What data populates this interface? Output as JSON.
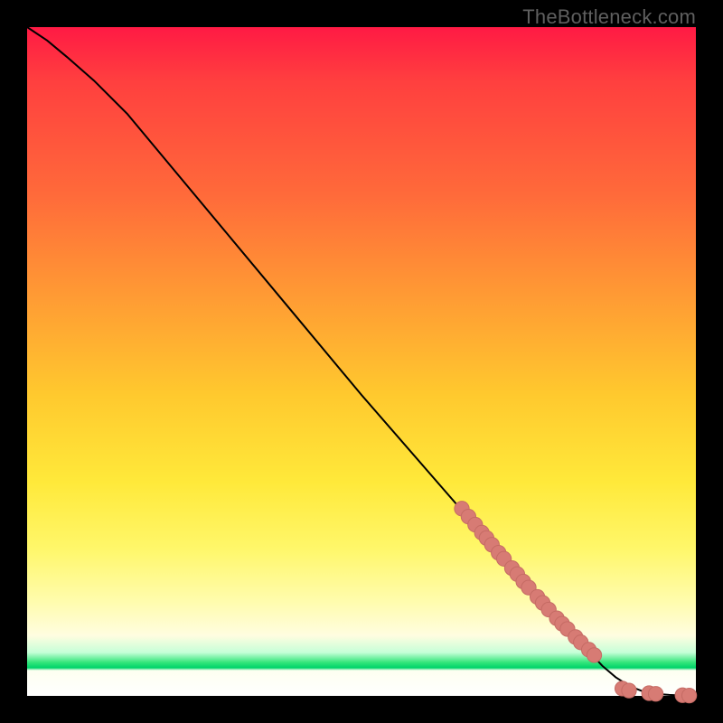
{
  "watermark": "TheBottleneck.com",
  "colors": {
    "background": "#000000",
    "curve": "#000000",
    "marker_fill": "#d77b74",
    "marker_stroke": "#c56b64"
  },
  "chart_data": {
    "type": "line",
    "title": "",
    "xlabel": "",
    "ylabel": "",
    "xlim": [
      0,
      100
    ],
    "ylim": [
      0,
      100
    ],
    "series": [
      {
        "name": "curve",
        "x": [
          0,
          3,
          6,
          10,
          15,
          20,
          30,
          40,
          50,
          60,
          70,
          80,
          86,
          88,
          90,
          92,
          94,
          96,
          98,
          100
        ],
        "y": [
          100,
          98,
          95.5,
          92,
          87,
          81,
          69,
          57,
          45,
          33.5,
          22,
          11,
          4.5,
          2.8,
          1.5,
          0.7,
          0.3,
          0.15,
          0.05,
          0
        ]
      }
    ],
    "markers": [
      {
        "x": 65,
        "y": 28,
        "r": 1.1
      },
      {
        "x": 66,
        "y": 26.8,
        "r": 1.1
      },
      {
        "x": 67,
        "y": 25.6,
        "r": 1.1
      },
      {
        "x": 68,
        "y": 24.4,
        "r": 1.1
      },
      {
        "x": 68.7,
        "y": 23.6,
        "r": 1.1
      },
      {
        "x": 69.5,
        "y": 22.6,
        "r": 1.1
      },
      {
        "x": 70.5,
        "y": 21.4,
        "r": 1.1
      },
      {
        "x": 71.3,
        "y": 20.5,
        "r": 1.1
      },
      {
        "x": 72.5,
        "y": 19.1,
        "r": 1.1
      },
      {
        "x": 73.3,
        "y": 18.2,
        "r": 1.1
      },
      {
        "x": 74.2,
        "y": 17.1,
        "r": 1.1
      },
      {
        "x": 75,
        "y": 16.2,
        "r": 1.1
      },
      {
        "x": 76.3,
        "y": 14.8,
        "r": 1.1
      },
      {
        "x": 77.1,
        "y": 13.9,
        "r": 1.1
      },
      {
        "x": 78,
        "y": 12.9,
        "r": 1.1
      },
      {
        "x": 79.2,
        "y": 11.6,
        "r": 1.1
      },
      {
        "x": 80,
        "y": 10.8,
        "r": 1.1
      },
      {
        "x": 80.8,
        "y": 10,
        "r": 1.1
      },
      {
        "x": 82,
        "y": 8.8,
        "r": 1.1
      },
      {
        "x": 82.8,
        "y": 8,
        "r": 1.1
      },
      {
        "x": 84,
        "y": 6.9,
        "r": 1.1
      },
      {
        "x": 84.8,
        "y": 6.1,
        "r": 1.1
      },
      {
        "x": 89,
        "y": 1.1,
        "r": 1.1
      },
      {
        "x": 90,
        "y": 0.8,
        "r": 1.1
      },
      {
        "x": 93,
        "y": 0.4,
        "r": 1.1
      },
      {
        "x": 94,
        "y": 0.3,
        "r": 1.1
      },
      {
        "x": 98,
        "y": 0.1,
        "r": 1.1
      },
      {
        "x": 99,
        "y": 0.05,
        "r": 1.1
      }
    ]
  }
}
